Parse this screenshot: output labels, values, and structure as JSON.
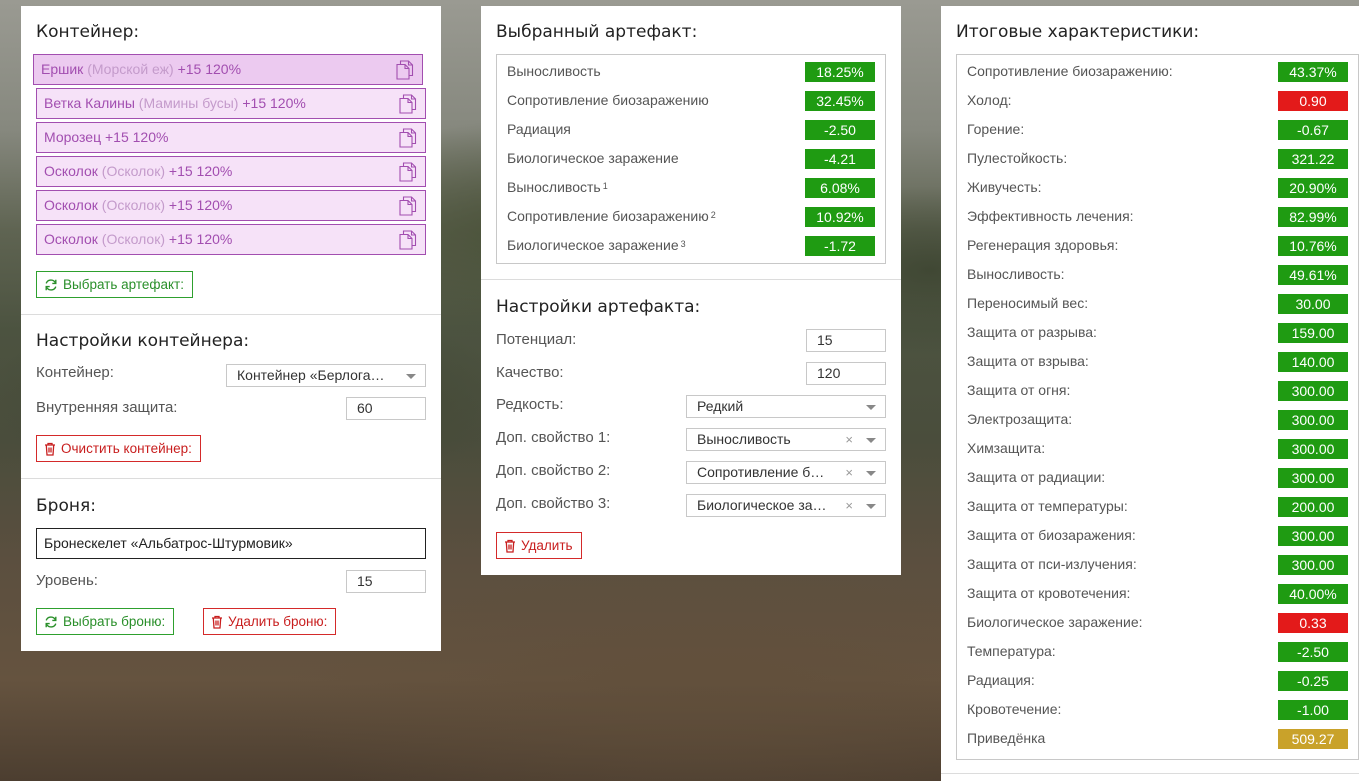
{
  "container_panel": {
    "title": "Контейнер:",
    "items": [
      {
        "name": "Ершик",
        "sub": "(Морской еж)",
        "bonus": "+15 120%",
        "selected": true
      },
      {
        "name": "Ветка Калины",
        "sub": "(Мамины бусы)",
        "bonus": "+15 120%",
        "selected": false
      },
      {
        "name": "Морозец",
        "sub": "",
        "bonus": "+15 120%",
        "selected": false
      },
      {
        "name": "Осколок",
        "sub": "(Осколок)",
        "bonus": "+15 120%",
        "selected": false
      },
      {
        "name": "Осколок",
        "sub": "(Осколок)",
        "bonus": "+15 120%",
        "selected": false
      },
      {
        "name": "Осколок",
        "sub": "(Осколок)",
        "bonus": "+15 120%",
        "selected": false
      }
    ],
    "select_artifact_button": "Выбрать артефакт:"
  },
  "container_settings": {
    "title": "Настройки контейнера:",
    "container_label": "Контейнер:",
    "container_value": "Контейнер «Берлога…",
    "protection_label": "Внутренняя защита:",
    "protection_value": "60",
    "clear_button": "Очистить контейнер:"
  },
  "armor": {
    "title": "Броня:",
    "name": "Бронескелет «Альбатрос-Штурмовик»",
    "level_label": "Уровень:",
    "level_value": "15",
    "select_button": "Выбрать броню:",
    "delete_button": "Удалить броню:"
  },
  "selected_artifact": {
    "title": "Выбранный артефакт:",
    "stats": [
      {
        "name": "Выносливость",
        "sup": "",
        "value": "18.25%",
        "color": "green"
      },
      {
        "name": "Сопротивление биозаражению",
        "sup": "",
        "value": "32.45%",
        "color": "green"
      },
      {
        "name": "Радиация",
        "sup": "",
        "value": "-2.50",
        "color": "green"
      },
      {
        "name": "Биологическое заражение",
        "sup": "",
        "value": "-4.21",
        "color": "green"
      },
      {
        "name": "Выносливость",
        "sup": "1",
        "value": "6.08%",
        "color": "green"
      },
      {
        "name": "Сопротивление биозаражению",
        "sup": "2",
        "value": "10.92%",
        "color": "green"
      },
      {
        "name": "Биологическое заражение",
        "sup": "3",
        "value": "-1.72",
        "color": "green"
      }
    ]
  },
  "artifact_settings": {
    "title": "Настройки артефакта:",
    "potential_label": "Потенциал:",
    "potential_value": "15",
    "quality_label": "Качество:",
    "quality_value": "120",
    "rarity_label": "Редкость:",
    "rarity_value": "Редкий",
    "prop1_label": "Доп. свойство 1:",
    "prop1_value": "Выносливость",
    "prop2_label": "Доп. свойство 2:",
    "prop2_value": "Сопротивление б…",
    "prop3_label": "Доп. свойство 3:",
    "prop3_value": "Биологическое за…",
    "clear_symbol": "×",
    "delete_button": "Удалить"
  },
  "total_stats": {
    "title": "Итоговые характеристики:",
    "stats": [
      {
        "name": "Сопротивление биозаражению:",
        "value": "43.37%",
        "color": "green"
      },
      {
        "name": "Холод:",
        "value": "0.90",
        "color": "red"
      },
      {
        "name": "Горение:",
        "value": "-0.67",
        "color": "green"
      },
      {
        "name": "Пулестойкость:",
        "value": "321.22",
        "color": "green"
      },
      {
        "name": "Живучесть:",
        "value": "20.90%",
        "color": "green"
      },
      {
        "name": "Эффективность лечения:",
        "value": "82.99%",
        "color": "green"
      },
      {
        "name": "Регенерация здоровья:",
        "value": "10.76%",
        "color": "green"
      },
      {
        "name": "Выносливость:",
        "value": "49.61%",
        "color": "green"
      },
      {
        "name": "Переносимый вес:",
        "value": "30.00",
        "color": "green"
      },
      {
        "name": "Защита от разрыва:",
        "value": "159.00",
        "color": "green"
      },
      {
        "name": "Защита от взрыва:",
        "value": "140.00",
        "color": "green"
      },
      {
        "name": "Защита от огня:",
        "value": "300.00",
        "color": "green"
      },
      {
        "name": "Электрозащита:",
        "value": "300.00",
        "color": "green"
      },
      {
        "name": "Химзащита:",
        "value": "300.00",
        "color": "green"
      },
      {
        "name": "Защита от радиации:",
        "value": "300.00",
        "color": "green"
      },
      {
        "name": "Защита от температуры:",
        "value": "200.00",
        "color": "green"
      },
      {
        "name": "Защита от биозаражения:",
        "value": "300.00",
        "color": "green"
      },
      {
        "name": "Защита от пси-излучения:",
        "value": "300.00",
        "color": "green"
      },
      {
        "name": "Защита от кровотечения:",
        "value": "40.00%",
        "color": "green"
      },
      {
        "name": "Биологическое заражение:",
        "value": "0.33",
        "color": "red"
      },
      {
        "name": "Температура:",
        "value": "-2.50",
        "color": "green"
      },
      {
        "name": "Радиация:",
        "value": "-0.25",
        "color": "green"
      },
      {
        "name": "Кровотечение:",
        "value": "-1.00",
        "color": "green"
      },
      {
        "name": "Приведёнка",
        "value": "509.27",
        "color": "yellow"
      }
    ]
  },
  "colors": {
    "green": "#1f9b12",
    "red": "#e31a1a",
    "yellow": "#c9a22a",
    "artifact_purple": "#a24eb0"
  },
  "icons": {
    "copy": "copy-icon",
    "refresh": "refresh-icon",
    "trash": "trash-icon"
  }
}
